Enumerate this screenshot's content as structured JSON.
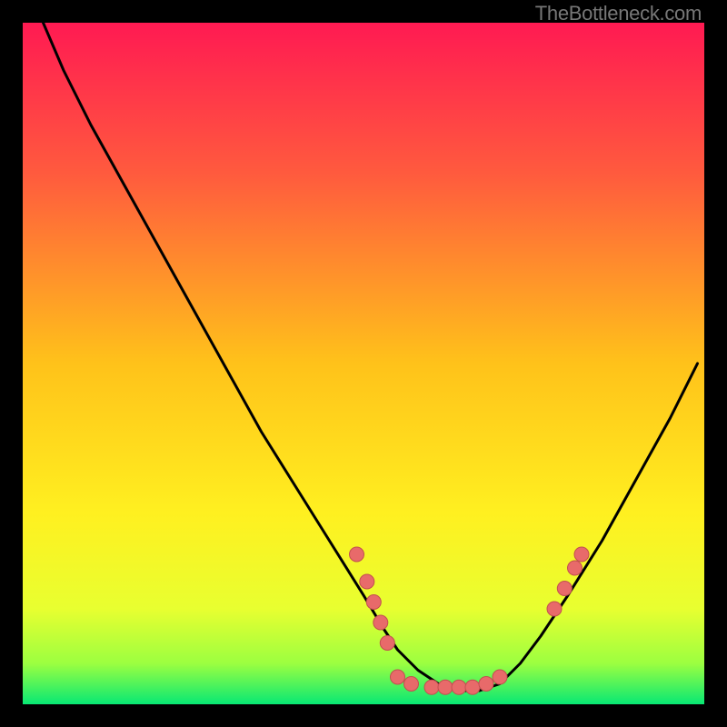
{
  "watermark": "TheBottleneck.com",
  "colors": {
    "gradient_top": "#ff1a52",
    "gradient_mid_upper": "#ff6a3a",
    "gradient_mid": "#ffd21a",
    "gradient_lower": "#f8ff2a",
    "gradient_near_bottom": "#d0ff3a",
    "gradient_bottom": "#08e874",
    "curve": "#000000",
    "dot_fill": "#e86a6a",
    "dot_stroke": "#c24f4f"
  },
  "chart_data": {
    "type": "line",
    "title": "",
    "xlabel": "",
    "ylabel": "",
    "xlim": [
      0,
      100
    ],
    "ylim": [
      0,
      100
    ],
    "series": [
      {
        "name": "bottleneck-curve",
        "x": [
          3,
          6,
          10,
          15,
          20,
          25,
          30,
          35,
          40,
          45,
          50,
          53,
          55,
          58,
          61,
          64,
          67,
          70,
          73,
          76,
          80,
          85,
          90,
          95,
          99
        ],
        "y": [
          100,
          93,
          85,
          76,
          67,
          58,
          49,
          40,
          32,
          24,
          16,
          11,
          8,
          5,
          3,
          2,
          2,
          3,
          6,
          10,
          16,
          24,
          33,
          42,
          50
        ]
      }
    ],
    "points": [
      {
        "x": 49,
        "y": 22
      },
      {
        "x": 50.5,
        "y": 18
      },
      {
        "x": 51.5,
        "y": 15
      },
      {
        "x": 52.5,
        "y": 12
      },
      {
        "x": 53.5,
        "y": 9
      },
      {
        "x": 55,
        "y": 4
      },
      {
        "x": 57,
        "y": 3
      },
      {
        "x": 60,
        "y": 2.5
      },
      {
        "x": 62,
        "y": 2.5
      },
      {
        "x": 64,
        "y": 2.5
      },
      {
        "x": 66,
        "y": 2.5
      },
      {
        "x": 68,
        "y": 3
      },
      {
        "x": 70,
        "y": 4
      },
      {
        "x": 78,
        "y": 14
      },
      {
        "x": 79.5,
        "y": 17
      },
      {
        "x": 81,
        "y": 20
      },
      {
        "x": 82,
        "y": 22
      }
    ]
  }
}
